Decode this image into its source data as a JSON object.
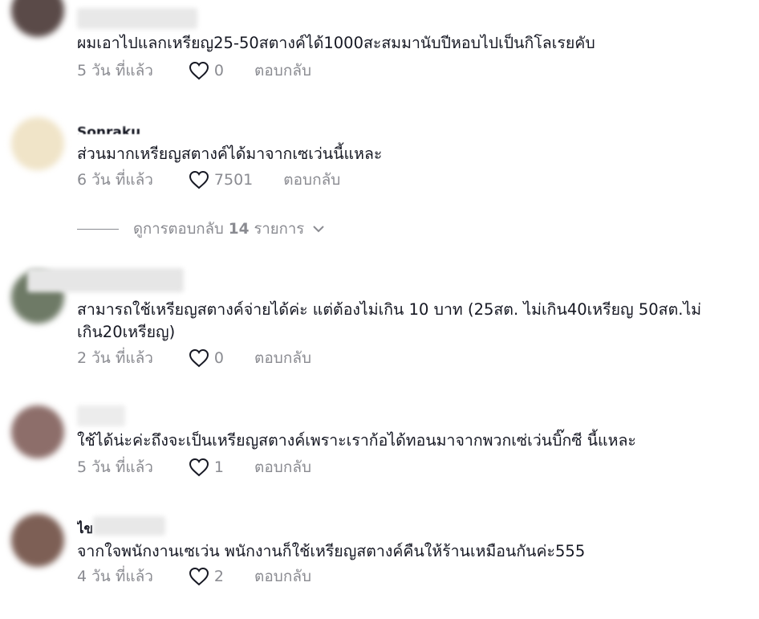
{
  "comments": [
    {
      "text": "ผมเอาไปแลกเหรียญ25-50สตางค์ได้1000สะสมมานับปีหอบไปเป็นกิโลเรยคับ",
      "time": "5 วัน ที่แล้ว",
      "likes": "0",
      "reply": "ตอบกลับ"
    },
    {
      "name": "Sonraku",
      "text": "ส่วนมากเหรียญสตางค์ได้มาจากเซเว่นนี้แหละ",
      "time": "6 วัน ที่แล้ว",
      "likes": "7501",
      "reply": "ตอบกลับ"
    },
    {
      "text": "สามารถใช้เหรียญสตางค์จ่ายได้ค่ะ แต่ต้องไม่เกิน 10 บาท (25สต. ไม่เกิน40เหรียญ 50สต.ไม่เกิน20เหรียญ)",
      "time": "2 วัน ที่แล้ว",
      "likes": "0",
      "reply": "ตอบกลับ"
    },
    {
      "text": "ใช้ได้น่ะค่ะถึงจะเป็นเหรียญสตางค์เพราะเราก้อได้ทอนมาจากพวกเซ่เว่นบิ๊กซี นี้แหละ",
      "time": "5 วัน ที่แล้ว",
      "likes": "1",
      "reply": "ตอบกลับ"
    },
    {
      "name": "ไข",
      "text": "จากใจพนักงานเซเว่น พนักงานก็ใช้เหรียญสตางค์คืนให้ร้านเหมือนกันค่ะ555",
      "time": "4 วัน ที่แล้ว",
      "likes": "2",
      "reply": "ตอบกลับ"
    }
  ],
  "view_replies": {
    "prefix": "ดูการตอบกลับ",
    "count": "14",
    "suffix": "รายการ"
  },
  "icons": {
    "like": "heart-outline-icon",
    "expand": "chevron-down-icon"
  },
  "colors": {
    "text": "#161823",
    "meta": "#8a8b91"
  }
}
